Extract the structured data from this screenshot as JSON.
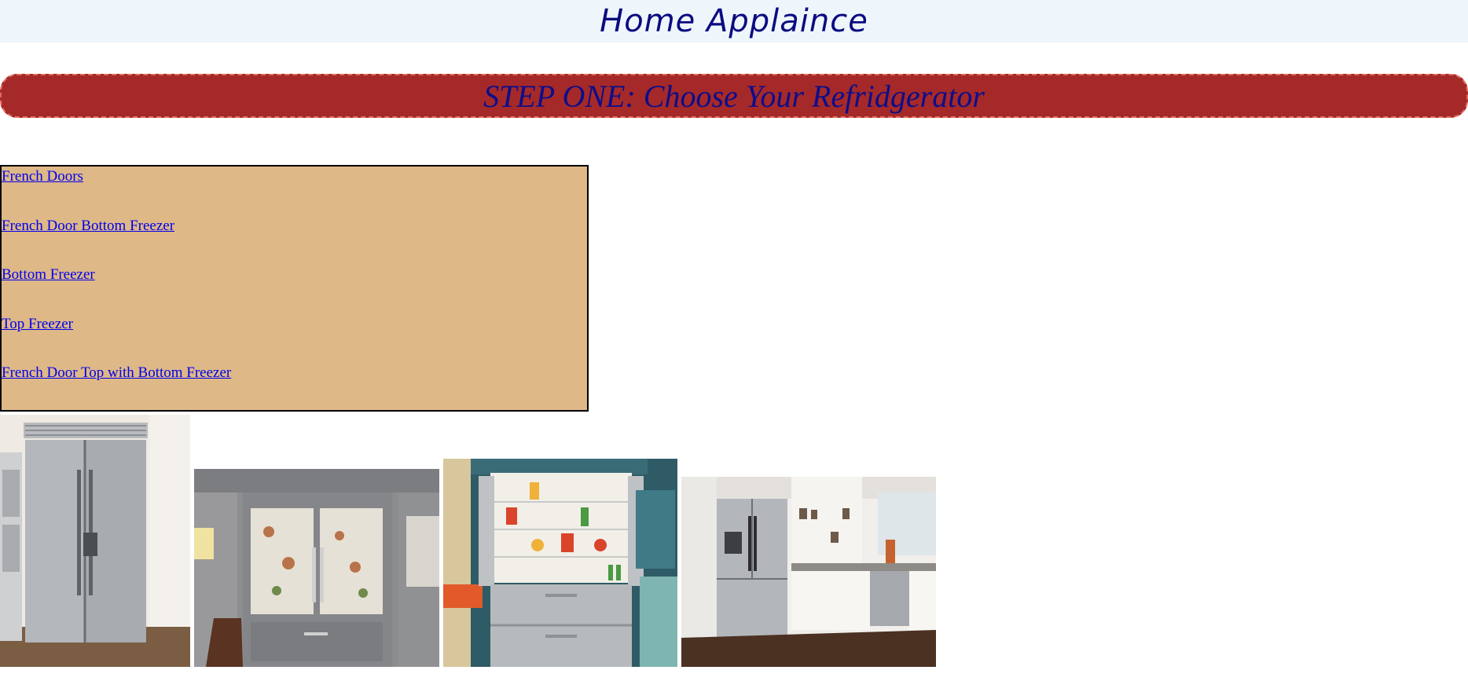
{
  "header": {
    "title": "Home Applaince"
  },
  "banner": {
    "title": "STEP ONE: Choose Your Refridgerator"
  },
  "menu": {
    "items": [
      {
        "label": "French Doors"
      },
      {
        "label": "French Door Bottom Freezer"
      },
      {
        "label": "Bottom Freezer"
      },
      {
        "label": "Top Freezer"
      },
      {
        "label": "French Door Top with Bottom Freezer"
      }
    ]
  },
  "colors": {
    "header_bg": "#eef6fc",
    "title_text": "#0b0b80",
    "banner_bg": "#a52929",
    "menu_bg": "#deb887",
    "link": "#0000ee"
  }
}
